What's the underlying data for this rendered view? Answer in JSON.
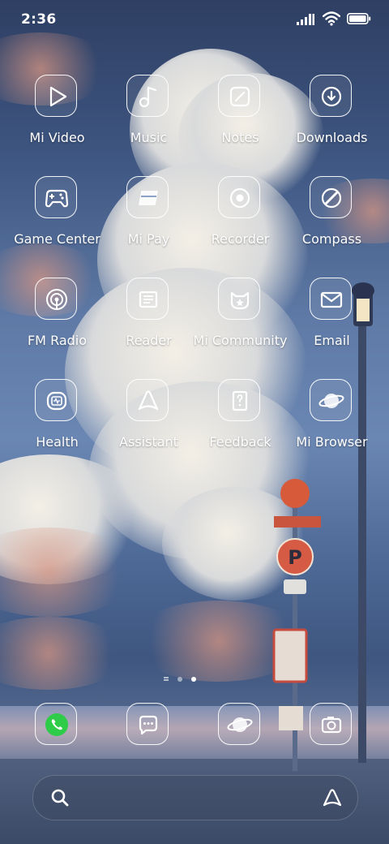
{
  "status_bar": {
    "time": "2:36"
  },
  "apps": [
    {
      "label": "Mi Video",
      "icon": "play-icon"
    },
    {
      "label": "Music",
      "icon": "music-note-icon"
    },
    {
      "label": "Notes",
      "icon": "pencil-icon"
    },
    {
      "label": "Downloads",
      "icon": "download-icon"
    },
    {
      "label": "Game Center",
      "icon": "gamepad-icon"
    },
    {
      "label": "Mi Pay",
      "icon": "card-icon"
    },
    {
      "label": "Recorder",
      "icon": "record-icon"
    },
    {
      "label": "Compass",
      "icon": "compass-icon"
    },
    {
      "label": "FM Radio",
      "icon": "radio-icon"
    },
    {
      "label": "Reader",
      "icon": "book-icon"
    },
    {
      "label": "Mi Community",
      "icon": "community-icon"
    },
    {
      "label": "Email",
      "icon": "envelope-icon"
    },
    {
      "label": "Health",
      "icon": "health-icon"
    },
    {
      "label": "Assistant",
      "icon": "assistant-icon"
    },
    {
      "label": "Feedback",
      "icon": "feedback-icon"
    },
    {
      "label": "Mi Browser",
      "icon": "planet-icon"
    }
  ],
  "page_indicator": {
    "pages": 2,
    "active_index": 1
  },
  "dock": [
    {
      "icon": "phone-icon"
    },
    {
      "icon": "chat-icon"
    },
    {
      "icon": "planet-icon"
    },
    {
      "icon": "camera-icon"
    }
  ],
  "search_bar": {
    "left_icon": "search-icon",
    "right_icon": "assistant-icon"
  },
  "colors": {
    "phone_green": "#2ecc48",
    "tile_border": "#ffffff"
  }
}
